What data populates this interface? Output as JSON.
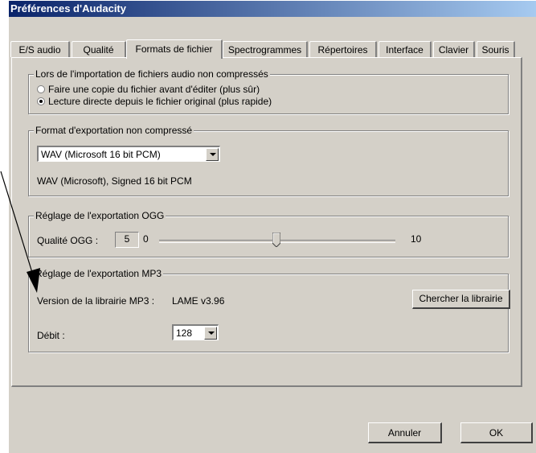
{
  "window": {
    "title": "Préférences d'Audacity"
  },
  "tabs": [
    {
      "label": "E/S audio"
    },
    {
      "label": "Qualité"
    },
    {
      "label": "Formats de fichier",
      "active": true
    },
    {
      "label": "Spectrogrammes"
    },
    {
      "label": "Répertoires"
    },
    {
      "label": "Interface"
    },
    {
      "label": "Clavier"
    },
    {
      "label": "Souris"
    }
  ],
  "import_group": {
    "legend": "Lors de l'importation de fichiers audio non compressés",
    "options": [
      {
        "label": "Faire une copie du fichier avant d'éditer (plus sûr)",
        "selected": false
      },
      {
        "label": "Lecture directe depuis le fichier original (plus rapide)",
        "selected": true
      }
    ]
  },
  "export_format_group": {
    "legend": "Format d'exportation non compressé",
    "format_selected": "WAV (Microsoft 16 bit PCM)",
    "format_description": "WAV (Microsoft), Signed 16 bit PCM"
  },
  "ogg_group": {
    "legend": "Réglage de l'exportation OGG",
    "quality_label": "Qualité OGG :",
    "quality_value": "5",
    "slider_min": "0",
    "slider_max": "10"
  },
  "mp3_group": {
    "legend": "Réglage de l'exportation MP3",
    "version_label": "Version de la librairie MP3 :",
    "version_value": "LAME v3.96",
    "find_library_button": "Chercher la librairie",
    "bitrate_label": "Débit :",
    "bitrate_value": "128"
  },
  "footer": {
    "cancel_button": "Annuler",
    "ok_button": "OK"
  },
  "colors": {
    "dialog_bg": "#d4d0c8",
    "titlebar_start": "#0a246a",
    "titlebar_end": "#a6caf0"
  }
}
